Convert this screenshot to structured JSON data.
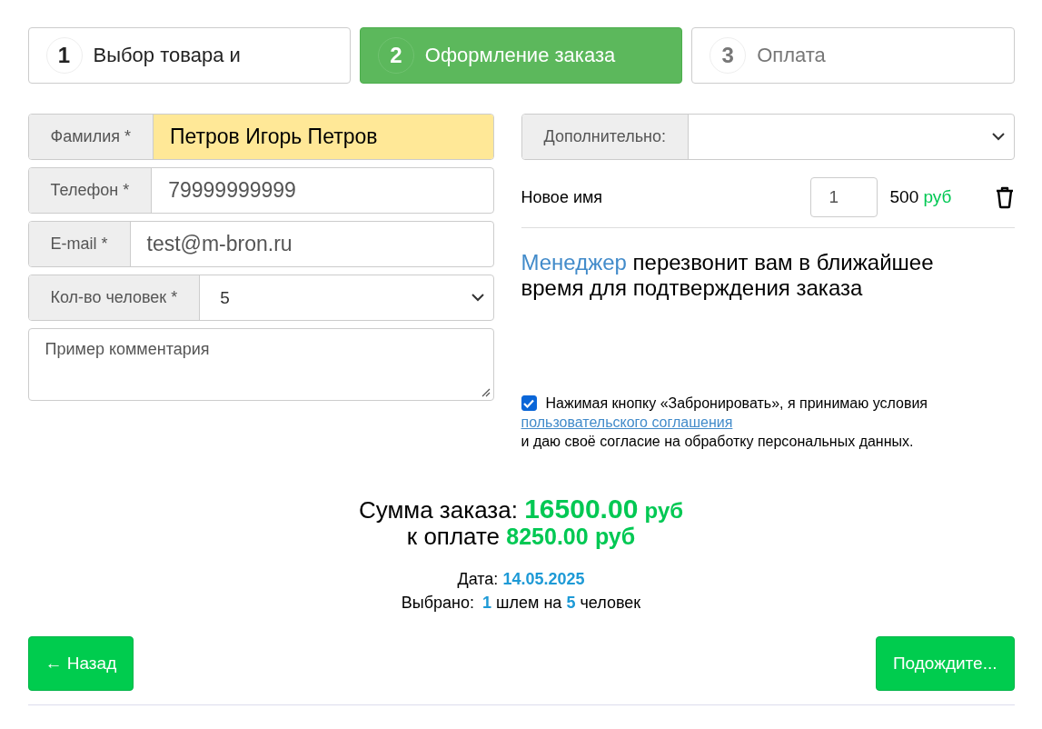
{
  "steps": [
    {
      "number": "1",
      "label": "Выбор товара и",
      "selected": false,
      "disabled": false
    },
    {
      "number": "2",
      "label": "Оформление заказа",
      "selected": true,
      "disabled": false
    },
    {
      "number": "3",
      "label": "Оплата",
      "selected": false,
      "disabled": true
    }
  ],
  "form": {
    "fields": [
      {
        "kind": "text",
        "label": "Фамилия *",
        "value": "Петров Игорь Петров",
        "highlighted": true
      },
      {
        "kind": "text",
        "label": "Телефон *",
        "value": "79999999999",
        "highlighted": false
      },
      {
        "kind": "text",
        "label": "E-mail *",
        "value": "test@m-bron.ru",
        "highlighted": false
      },
      {
        "kind": "select",
        "label": "Кол-во человек *",
        "value": "5",
        "highlighted": false
      },
      {
        "kind": "textarea",
        "value": "Пример комментария",
        "highlighted": false
      }
    ]
  },
  "extras": {
    "label": "Дополнительно:"
  },
  "items": [
    {
      "name": "Новое имя",
      "quantity": "1",
      "price": "500",
      "currency": "руб"
    }
  ],
  "notice": {
    "highlight": "Менеджер",
    "text": "перезвонит вам в ближайшее время для подтверждения заказа"
  },
  "consent": {
    "checked": true,
    "text": "Нажимая кнопку «Забронировать», я принимаю условия",
    "link": "пользовательского соглашения",
    "text_after": "и даю своё согласие на обработку персональных данных."
  },
  "summary": {
    "total_label": "Сумма заказа:",
    "total": "16500.00",
    "total_currency": "руб",
    "pay_label": "к оплате",
    "pay": "8250.00",
    "pay_currency": "руб",
    "date_label": "Дата:",
    "date": "14.05.2025",
    "chosen": [
      {
        "kind": "label",
        "text": "Выбрано:"
      },
      {
        "kind": "number",
        "text": "1"
      },
      {
        "kind": "label",
        "text": "шлем на"
      },
      {
        "kind": "number",
        "text": "5"
      },
      {
        "kind": "label",
        "text": "человек"
      }
    ]
  },
  "buttons": {
    "back": "← Назад",
    "next": "Подождите..."
  }
}
